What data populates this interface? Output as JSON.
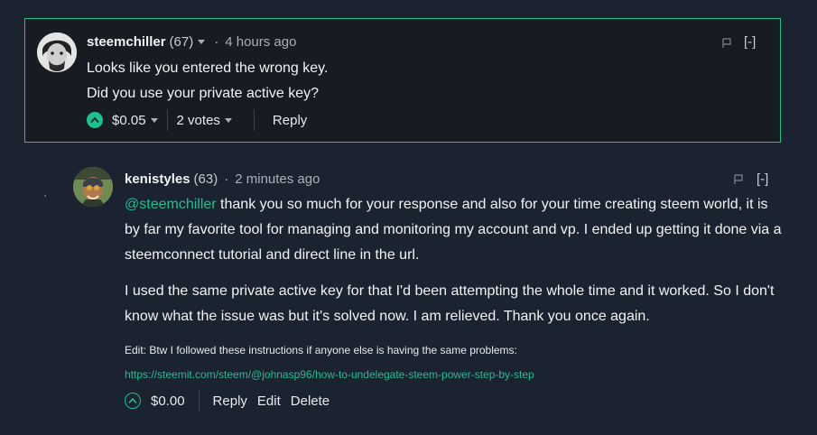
{
  "comment1": {
    "author": "steemchiller",
    "reputation": "(67)",
    "dot": "·",
    "time": "4 hours ago",
    "collapse": "[-]",
    "lines": [
      "Looks like you entered the wrong key.",
      "Did you use your private active key?"
    ],
    "payout": "$0.05",
    "votes": "2 votes",
    "reply": "Reply"
  },
  "comment2": {
    "author": "kenistyles",
    "reputation": "(63)",
    "dot": "·",
    "time": "2 minutes ago",
    "collapse": "[-]",
    "mention": "@steemchiller",
    "para1": " thank you so much for your response and also for your time creating steem world, it is by far my favorite tool for managing and monitoring my account and vp. I ended up getting it done via a steemconnect tutorial and direct line in the url.",
    "para2": "I used the same private active key for that I'd been attempting the whole time and it worked. So I don't know what the issue was but it's solved now. I am relieved. Thank you once again.",
    "edit_note": "Edit: Btw I followed these instructions if anyone else is having the same problems:",
    "edit_link": "https://steemit.com/steem/@johnasp96/how-to-undelegate-steem-power-step-by-step",
    "payout": "$0.00",
    "reply": "Reply",
    "edit": "Edit",
    "delete": "Delete"
  },
  "colors": {
    "accent": "#1fbf8f",
    "background": "#1c2330",
    "card": "#171c23"
  }
}
